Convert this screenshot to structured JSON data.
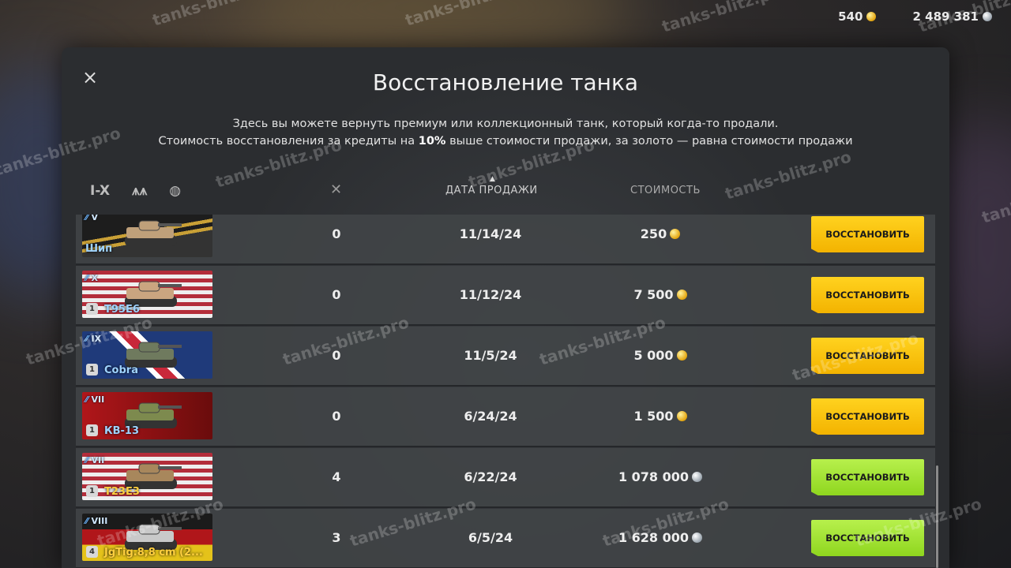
{
  "currency": {
    "gold": "540",
    "silver": "2 489 381"
  },
  "dialog": {
    "title": "Восстановление танка",
    "desc_line1": "Здесь вы можете вернуть премиум или коллекционный танк, который когда-то продали.",
    "desc_line2_a": "Стоимость восстановления за кредиты на ",
    "desc_line2_b": "10%",
    "desc_line2_c": " выше стоимости продажи, за золото — равна стоимости продажи",
    "close": "×"
  },
  "filters": {
    "tier": "I-X",
    "type": "⩚⩚",
    "nation": "◍"
  },
  "headers": {
    "kills": "✕",
    "date": "ДАТА ПРОДАЖИ",
    "cost": "СТОИМОСТЬ",
    "sort": "▲"
  },
  "rows": [
    {
      "tier": "V",
      "name": "Шип",
      "name_color": "#9fd3ff",
      "mastery": "",
      "kills": "0",
      "date": "11/14/24",
      "cost": "250",
      "currency": "gold",
      "button": "ВОССТАНОВИТЬ",
      "flag": "ussr_stripes"
    },
    {
      "tier": "X",
      "name": "T95E6",
      "name_color": "#9fd3ff",
      "mastery": "1",
      "kills": "0",
      "date": "11/12/24",
      "cost": "7 500",
      "currency": "gold",
      "button": "ВОССТАНОВИТЬ",
      "flag": "usa"
    },
    {
      "tier": "IX",
      "name": "Cobra",
      "name_color": "#9fd3ff",
      "mastery": "1",
      "kills": "0",
      "date": "11/5/24",
      "cost": "5 000",
      "currency": "gold",
      "button": "ВОССТАНОВИТЬ",
      "flag": "uk"
    },
    {
      "tier": "VII",
      "name": "КВ-13",
      "name_color": "#9fd3ff",
      "mastery": "1",
      "kills": "0",
      "date": "6/24/24",
      "cost": "1 500",
      "currency": "gold",
      "button": "ВОССТАНОВИТЬ",
      "flag": "ussr"
    },
    {
      "tier": "VII",
      "name": "T23E3",
      "name_color": "#ffcf3f",
      "mastery": "1",
      "kills": "4",
      "date": "6/22/24",
      "cost": "1 078 000",
      "currency": "silver",
      "button": "ВОССТАНОВИТЬ",
      "flag": "usa"
    },
    {
      "tier": "VIII",
      "name": "JgTig.8,8 cm (2...",
      "name_color": "#ffcf3f",
      "mastery": "4",
      "kills": "3",
      "date": "6/5/24",
      "cost": "1 628 000",
      "currency": "silver",
      "button": "ВОССТАНОВИТЬ",
      "flag": "germany"
    }
  ],
  "watermark": "tanks-blitz.pro"
}
